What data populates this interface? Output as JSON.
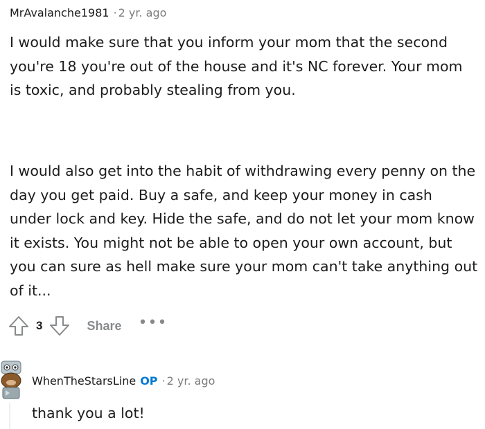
{
  "comment": {
    "author": "MrAvalanche1981",
    "separator": "·",
    "time": "2 yr. ago",
    "paragraph_1": "I would make sure that you inform your mom that the second you're 18 you're out of the house and it's NC forever. Your mom is toxic, and probably stealing from you.",
    "paragraph_2": "I would also get into the habit of withdrawing every penny on the day you get paid. Buy a safe, and keep your money in cash under lock and key. Hide the safe, and do not let your mom know it exists. You might not be able to open your own account, but you can sure as hell make sure your mom can't take anything out of it...",
    "vote_count": "3",
    "share_label": "Share",
    "more_label": "•••"
  },
  "reply": {
    "author": "WhenTheStarsLine",
    "badge": "OP",
    "separator": "·",
    "time": "2 yr. ago",
    "body": "thank you a lot!"
  },
  "icons": {
    "upvote": "upvote-arrow-icon",
    "downvote": "downvote-arrow-icon",
    "more": "more-options-icon",
    "avatar": "snoo-avatar"
  },
  "colors": {
    "text": "#1c1c1c",
    "meta": "#7c7c7c",
    "action": "#878a8c",
    "op_badge": "#0079d3"
  }
}
